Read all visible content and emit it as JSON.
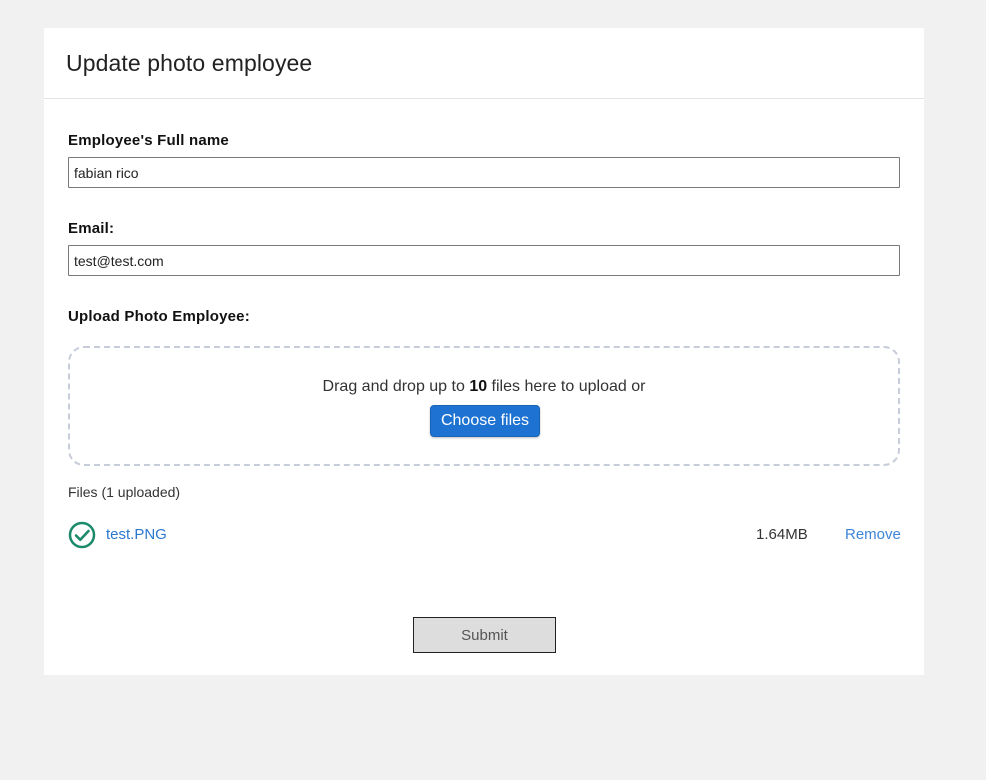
{
  "page": {
    "title": "Update photo employee"
  },
  "form": {
    "full_name_label": "Employee's Full name",
    "full_name_value": "fabian rico",
    "email_label": "Email:",
    "email_value": "test@test.com",
    "upload_label": "Upload Photo Employee:",
    "submit_label": "Submit"
  },
  "dropzone": {
    "text_before": "Drag and drop up to ",
    "max_files": "10",
    "text_after": " files here to upload or",
    "choose_label": "Choose files"
  },
  "files": {
    "header": "Files (1 uploaded)",
    "items": [
      {
        "name": "test.PNG",
        "size": "1.64MB",
        "remove_label": "Remove",
        "status": "uploaded",
        "status_icon": "check-circle-icon"
      }
    ]
  },
  "colors": {
    "accent": "#1e73d2",
    "link": "#2a78d0",
    "success": "#1a8a6a"
  }
}
